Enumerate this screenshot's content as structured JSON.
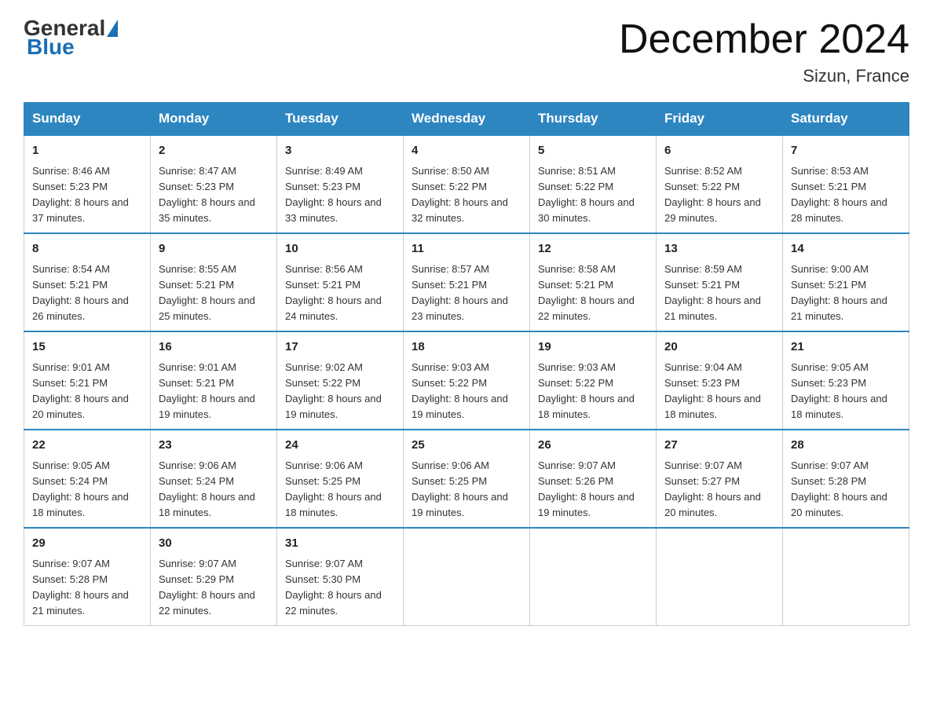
{
  "header": {
    "logo_general": "General",
    "logo_blue": "Blue",
    "month_title": "December 2024",
    "location": "Sizun, France"
  },
  "weekdays": [
    "Sunday",
    "Monday",
    "Tuesday",
    "Wednesday",
    "Thursday",
    "Friday",
    "Saturday"
  ],
  "weeks": [
    [
      {
        "day": "1",
        "sunrise": "Sunrise: 8:46 AM",
        "sunset": "Sunset: 5:23 PM",
        "daylight": "Daylight: 8 hours and 37 minutes."
      },
      {
        "day": "2",
        "sunrise": "Sunrise: 8:47 AM",
        "sunset": "Sunset: 5:23 PM",
        "daylight": "Daylight: 8 hours and 35 minutes."
      },
      {
        "day": "3",
        "sunrise": "Sunrise: 8:49 AM",
        "sunset": "Sunset: 5:23 PM",
        "daylight": "Daylight: 8 hours and 33 minutes."
      },
      {
        "day": "4",
        "sunrise": "Sunrise: 8:50 AM",
        "sunset": "Sunset: 5:22 PM",
        "daylight": "Daylight: 8 hours and 32 minutes."
      },
      {
        "day": "5",
        "sunrise": "Sunrise: 8:51 AM",
        "sunset": "Sunset: 5:22 PM",
        "daylight": "Daylight: 8 hours and 30 minutes."
      },
      {
        "day": "6",
        "sunrise": "Sunrise: 8:52 AM",
        "sunset": "Sunset: 5:22 PM",
        "daylight": "Daylight: 8 hours and 29 minutes."
      },
      {
        "day": "7",
        "sunrise": "Sunrise: 8:53 AM",
        "sunset": "Sunset: 5:21 PM",
        "daylight": "Daylight: 8 hours and 28 minutes."
      }
    ],
    [
      {
        "day": "8",
        "sunrise": "Sunrise: 8:54 AM",
        "sunset": "Sunset: 5:21 PM",
        "daylight": "Daylight: 8 hours and 26 minutes."
      },
      {
        "day": "9",
        "sunrise": "Sunrise: 8:55 AM",
        "sunset": "Sunset: 5:21 PM",
        "daylight": "Daylight: 8 hours and 25 minutes."
      },
      {
        "day": "10",
        "sunrise": "Sunrise: 8:56 AM",
        "sunset": "Sunset: 5:21 PM",
        "daylight": "Daylight: 8 hours and 24 minutes."
      },
      {
        "day": "11",
        "sunrise": "Sunrise: 8:57 AM",
        "sunset": "Sunset: 5:21 PM",
        "daylight": "Daylight: 8 hours and 23 minutes."
      },
      {
        "day": "12",
        "sunrise": "Sunrise: 8:58 AM",
        "sunset": "Sunset: 5:21 PM",
        "daylight": "Daylight: 8 hours and 22 minutes."
      },
      {
        "day": "13",
        "sunrise": "Sunrise: 8:59 AM",
        "sunset": "Sunset: 5:21 PM",
        "daylight": "Daylight: 8 hours and 21 minutes."
      },
      {
        "day": "14",
        "sunrise": "Sunrise: 9:00 AM",
        "sunset": "Sunset: 5:21 PM",
        "daylight": "Daylight: 8 hours and 21 minutes."
      }
    ],
    [
      {
        "day": "15",
        "sunrise": "Sunrise: 9:01 AM",
        "sunset": "Sunset: 5:21 PM",
        "daylight": "Daylight: 8 hours and 20 minutes."
      },
      {
        "day": "16",
        "sunrise": "Sunrise: 9:01 AM",
        "sunset": "Sunset: 5:21 PM",
        "daylight": "Daylight: 8 hours and 19 minutes."
      },
      {
        "day": "17",
        "sunrise": "Sunrise: 9:02 AM",
        "sunset": "Sunset: 5:22 PM",
        "daylight": "Daylight: 8 hours and 19 minutes."
      },
      {
        "day": "18",
        "sunrise": "Sunrise: 9:03 AM",
        "sunset": "Sunset: 5:22 PM",
        "daylight": "Daylight: 8 hours and 19 minutes."
      },
      {
        "day": "19",
        "sunrise": "Sunrise: 9:03 AM",
        "sunset": "Sunset: 5:22 PM",
        "daylight": "Daylight: 8 hours and 18 minutes."
      },
      {
        "day": "20",
        "sunrise": "Sunrise: 9:04 AM",
        "sunset": "Sunset: 5:23 PM",
        "daylight": "Daylight: 8 hours and 18 minutes."
      },
      {
        "day": "21",
        "sunrise": "Sunrise: 9:05 AM",
        "sunset": "Sunset: 5:23 PM",
        "daylight": "Daylight: 8 hours and 18 minutes."
      }
    ],
    [
      {
        "day": "22",
        "sunrise": "Sunrise: 9:05 AM",
        "sunset": "Sunset: 5:24 PM",
        "daylight": "Daylight: 8 hours and 18 minutes."
      },
      {
        "day": "23",
        "sunrise": "Sunrise: 9:06 AM",
        "sunset": "Sunset: 5:24 PM",
        "daylight": "Daylight: 8 hours and 18 minutes."
      },
      {
        "day": "24",
        "sunrise": "Sunrise: 9:06 AM",
        "sunset": "Sunset: 5:25 PM",
        "daylight": "Daylight: 8 hours and 18 minutes."
      },
      {
        "day": "25",
        "sunrise": "Sunrise: 9:06 AM",
        "sunset": "Sunset: 5:25 PM",
        "daylight": "Daylight: 8 hours and 19 minutes."
      },
      {
        "day": "26",
        "sunrise": "Sunrise: 9:07 AM",
        "sunset": "Sunset: 5:26 PM",
        "daylight": "Daylight: 8 hours and 19 minutes."
      },
      {
        "day": "27",
        "sunrise": "Sunrise: 9:07 AM",
        "sunset": "Sunset: 5:27 PM",
        "daylight": "Daylight: 8 hours and 20 minutes."
      },
      {
        "day": "28",
        "sunrise": "Sunrise: 9:07 AM",
        "sunset": "Sunset: 5:28 PM",
        "daylight": "Daylight: 8 hours and 20 minutes."
      }
    ],
    [
      {
        "day": "29",
        "sunrise": "Sunrise: 9:07 AM",
        "sunset": "Sunset: 5:28 PM",
        "daylight": "Daylight: 8 hours and 21 minutes."
      },
      {
        "day": "30",
        "sunrise": "Sunrise: 9:07 AM",
        "sunset": "Sunset: 5:29 PM",
        "daylight": "Daylight: 8 hours and 22 minutes."
      },
      {
        "day": "31",
        "sunrise": "Sunrise: 9:07 AM",
        "sunset": "Sunset: 5:30 PM",
        "daylight": "Daylight: 8 hours and 22 minutes."
      },
      null,
      null,
      null,
      null
    ]
  ]
}
